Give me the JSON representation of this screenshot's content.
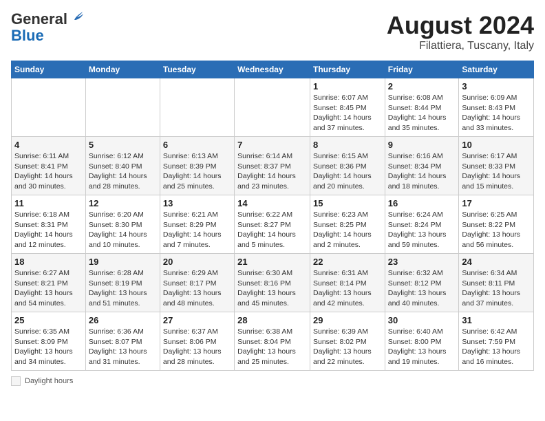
{
  "header": {
    "logo_general": "General",
    "logo_blue": "Blue",
    "month_title": "August 2024",
    "location": "Filattiera, Tuscany, Italy"
  },
  "weekdays": [
    "Sunday",
    "Monday",
    "Tuesday",
    "Wednesday",
    "Thursday",
    "Friday",
    "Saturday"
  ],
  "weeks": [
    [
      {
        "day": "",
        "info": ""
      },
      {
        "day": "",
        "info": ""
      },
      {
        "day": "",
        "info": ""
      },
      {
        "day": "",
        "info": ""
      },
      {
        "day": "1",
        "info": "Sunrise: 6:07 AM\nSunset: 8:45 PM\nDaylight: 14 hours\nand 37 minutes."
      },
      {
        "day": "2",
        "info": "Sunrise: 6:08 AM\nSunset: 8:44 PM\nDaylight: 14 hours\nand 35 minutes."
      },
      {
        "day": "3",
        "info": "Sunrise: 6:09 AM\nSunset: 8:43 PM\nDaylight: 14 hours\nand 33 minutes."
      }
    ],
    [
      {
        "day": "4",
        "info": "Sunrise: 6:11 AM\nSunset: 8:41 PM\nDaylight: 14 hours\nand 30 minutes."
      },
      {
        "day": "5",
        "info": "Sunrise: 6:12 AM\nSunset: 8:40 PM\nDaylight: 14 hours\nand 28 minutes."
      },
      {
        "day": "6",
        "info": "Sunrise: 6:13 AM\nSunset: 8:39 PM\nDaylight: 14 hours\nand 25 minutes."
      },
      {
        "day": "7",
        "info": "Sunrise: 6:14 AM\nSunset: 8:37 PM\nDaylight: 14 hours\nand 23 minutes."
      },
      {
        "day": "8",
        "info": "Sunrise: 6:15 AM\nSunset: 8:36 PM\nDaylight: 14 hours\nand 20 minutes."
      },
      {
        "day": "9",
        "info": "Sunrise: 6:16 AM\nSunset: 8:34 PM\nDaylight: 14 hours\nand 18 minutes."
      },
      {
        "day": "10",
        "info": "Sunrise: 6:17 AM\nSunset: 8:33 PM\nDaylight: 14 hours\nand 15 minutes."
      }
    ],
    [
      {
        "day": "11",
        "info": "Sunrise: 6:18 AM\nSunset: 8:31 PM\nDaylight: 14 hours\nand 12 minutes."
      },
      {
        "day": "12",
        "info": "Sunrise: 6:20 AM\nSunset: 8:30 PM\nDaylight: 14 hours\nand 10 minutes."
      },
      {
        "day": "13",
        "info": "Sunrise: 6:21 AM\nSunset: 8:29 PM\nDaylight: 14 hours\nand 7 minutes."
      },
      {
        "day": "14",
        "info": "Sunrise: 6:22 AM\nSunset: 8:27 PM\nDaylight: 14 hours\nand 5 minutes."
      },
      {
        "day": "15",
        "info": "Sunrise: 6:23 AM\nSunset: 8:25 PM\nDaylight: 14 hours\nand 2 minutes."
      },
      {
        "day": "16",
        "info": "Sunrise: 6:24 AM\nSunset: 8:24 PM\nDaylight: 13 hours\nand 59 minutes."
      },
      {
        "day": "17",
        "info": "Sunrise: 6:25 AM\nSunset: 8:22 PM\nDaylight: 13 hours\nand 56 minutes."
      }
    ],
    [
      {
        "day": "18",
        "info": "Sunrise: 6:27 AM\nSunset: 8:21 PM\nDaylight: 13 hours\nand 54 minutes."
      },
      {
        "day": "19",
        "info": "Sunrise: 6:28 AM\nSunset: 8:19 PM\nDaylight: 13 hours\nand 51 minutes."
      },
      {
        "day": "20",
        "info": "Sunrise: 6:29 AM\nSunset: 8:17 PM\nDaylight: 13 hours\nand 48 minutes."
      },
      {
        "day": "21",
        "info": "Sunrise: 6:30 AM\nSunset: 8:16 PM\nDaylight: 13 hours\nand 45 minutes."
      },
      {
        "day": "22",
        "info": "Sunrise: 6:31 AM\nSunset: 8:14 PM\nDaylight: 13 hours\nand 42 minutes."
      },
      {
        "day": "23",
        "info": "Sunrise: 6:32 AM\nSunset: 8:12 PM\nDaylight: 13 hours\nand 40 minutes."
      },
      {
        "day": "24",
        "info": "Sunrise: 6:34 AM\nSunset: 8:11 PM\nDaylight: 13 hours\nand 37 minutes."
      }
    ],
    [
      {
        "day": "25",
        "info": "Sunrise: 6:35 AM\nSunset: 8:09 PM\nDaylight: 13 hours\nand 34 minutes."
      },
      {
        "day": "26",
        "info": "Sunrise: 6:36 AM\nSunset: 8:07 PM\nDaylight: 13 hours\nand 31 minutes."
      },
      {
        "day": "27",
        "info": "Sunrise: 6:37 AM\nSunset: 8:06 PM\nDaylight: 13 hours\nand 28 minutes."
      },
      {
        "day": "28",
        "info": "Sunrise: 6:38 AM\nSunset: 8:04 PM\nDaylight: 13 hours\nand 25 minutes."
      },
      {
        "day": "29",
        "info": "Sunrise: 6:39 AM\nSunset: 8:02 PM\nDaylight: 13 hours\nand 22 minutes."
      },
      {
        "day": "30",
        "info": "Sunrise: 6:40 AM\nSunset: 8:00 PM\nDaylight: 13 hours\nand 19 minutes."
      },
      {
        "day": "31",
        "info": "Sunrise: 6:42 AM\nSunset: 7:59 PM\nDaylight: 13 hours\nand 16 minutes."
      }
    ]
  ],
  "footer": {
    "legend_label": "Daylight hours"
  }
}
